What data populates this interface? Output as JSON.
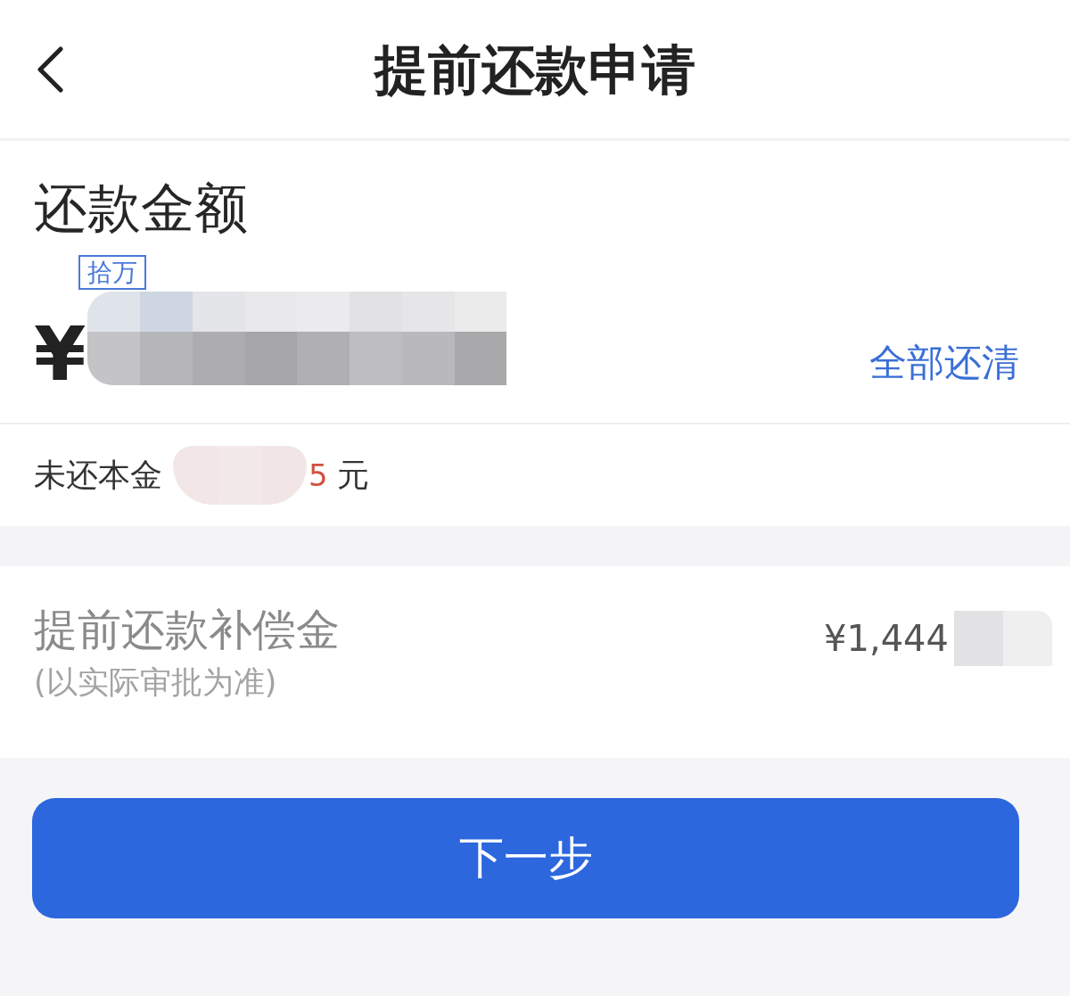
{
  "header": {
    "title": "提前还款申请"
  },
  "repayment": {
    "label": "还款金额",
    "unit_badge": "拾万",
    "currency": "¥",
    "pay_all_link": "全部还清"
  },
  "principal": {
    "label": "未还本金",
    "amount_tail": "5",
    "unit": "元"
  },
  "compensation": {
    "label": "提前还款补偿金",
    "note": "(以实际审批为准)",
    "amount": "¥1,444"
  },
  "next_button": {
    "label": "下一步"
  }
}
